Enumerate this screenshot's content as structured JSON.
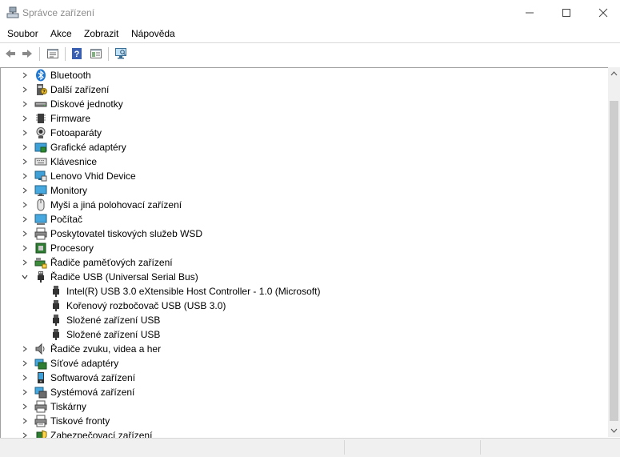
{
  "window": {
    "title": "Správce zařízení",
    "app_icon": "device-manager-icon"
  },
  "menu": [
    "Soubor",
    "Akce",
    "Zobrazit",
    "Nápověda"
  ],
  "toolbar": {
    "buttons": [
      "back-icon",
      "forward-icon",
      "properties-icon",
      "help-icon",
      "action-view-icon",
      "scan-hardware-icon"
    ]
  },
  "tree": {
    "categories": [
      {
        "label": "Bluetooth",
        "icon": "bluetooth-icon",
        "expanded": false
      },
      {
        "label": "Další zařízení",
        "icon": "other-device-icon",
        "expanded": false
      },
      {
        "label": "Diskové jednotky",
        "icon": "disk-drive-icon",
        "expanded": false
      },
      {
        "label": "Firmware",
        "icon": "firmware-icon",
        "expanded": false
      },
      {
        "label": "Fotoaparáty",
        "icon": "camera-icon",
        "expanded": false
      },
      {
        "label": "Grafické adaptéry",
        "icon": "display-adapter-icon",
        "expanded": false
      },
      {
        "label": "Klávesnice",
        "icon": "keyboard-icon",
        "expanded": false
      },
      {
        "label": "Lenovo Vhid Device",
        "icon": "hid-device-icon",
        "expanded": false
      },
      {
        "label": "Monitory",
        "icon": "monitor-icon",
        "expanded": false
      },
      {
        "label": "Myši a jiná polohovací zařízení",
        "icon": "mouse-icon",
        "expanded": false
      },
      {
        "label": "Počítač",
        "icon": "computer-icon",
        "expanded": false
      },
      {
        "label": "Poskytovatel tiskových služeb WSD",
        "icon": "printer-icon",
        "expanded": false
      },
      {
        "label": "Procesory",
        "icon": "processor-icon",
        "expanded": false
      },
      {
        "label": "Řadiče paměťových zařízení",
        "icon": "storage-controller-icon",
        "expanded": false
      },
      {
        "label": "Řadiče USB (Universal Serial Bus)",
        "icon": "usb-icon",
        "expanded": true,
        "children": [
          "Intel(R) USB 3.0 eXtensible Host Controller - 1.0 (Microsoft)",
          "Kořenový rozbočovač USB (USB 3.0)",
          "Složené zařízení USB",
          "Složené zařízení USB"
        ]
      },
      {
        "label": "Řadiče zvuku, videa a her",
        "icon": "speaker-icon",
        "expanded": false
      },
      {
        "label": "Síťové adaptéry",
        "icon": "network-adapter-icon",
        "expanded": false
      },
      {
        "label": "Softwarová zařízení",
        "icon": "software-device-icon",
        "expanded": false
      },
      {
        "label": "Systémová zařízení",
        "icon": "system-device-icon",
        "expanded": false
      },
      {
        "label": "Tiskárny",
        "icon": "printer-icon",
        "expanded": false
      },
      {
        "label": "Tiskové fronty",
        "icon": "print-queue-icon",
        "expanded": false
      },
      {
        "label": "Zabezpečovací zařízení",
        "icon": "security-device-icon",
        "expanded": false
      }
    ]
  }
}
